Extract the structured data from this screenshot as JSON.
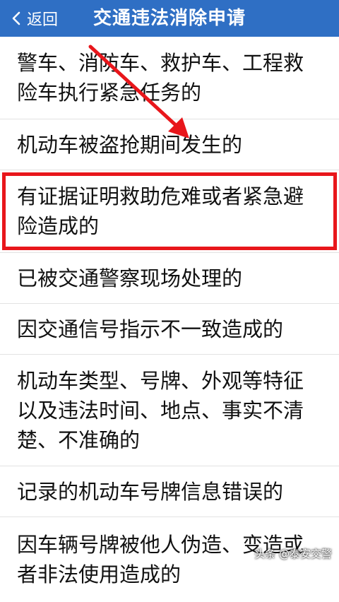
{
  "header": {
    "back_label": "返回",
    "title": "交通违法消除申请",
    "color": "#2f6fc4"
  },
  "items": [
    {
      "label": "警车、消防车、救护车、工程救险车执行紧急任务的"
    },
    {
      "label": "机动车被盗抢期间发生的"
    },
    {
      "label": "有证据证明救助危难或者紧急避险造成的",
      "highlighted": true
    },
    {
      "label": "已被交通警察现场处理的"
    },
    {
      "label": "因交通信号指示不一致造成的"
    },
    {
      "label": "机动车类型、号牌、外观等特征以及违法时间、地点、事实不清楚、不准确的"
    },
    {
      "label": "记录的机动车号牌信息错误的"
    },
    {
      "label": "因车辆号牌被他人伪造、变造或者非法使用造成的"
    }
  ],
  "annotation": {
    "highlight_color": "#e8161b",
    "arrow_icon": "red-arrow-icon"
  },
  "watermark": "头条 @泰安交警"
}
